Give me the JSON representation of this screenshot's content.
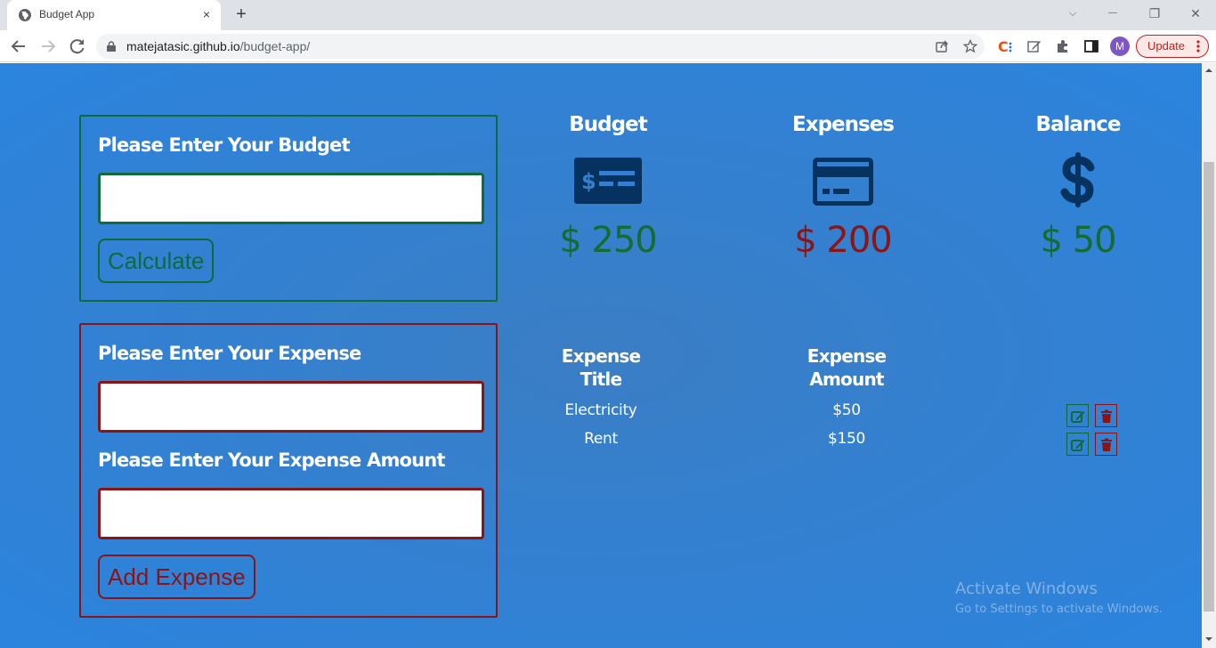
{
  "browser": {
    "tab": {
      "title": "Budget App",
      "close_label": "×",
      "favicon": "globe-icon"
    },
    "new_tab_label": "+",
    "window_controls": {
      "tab_search": "⌵",
      "minimize": "—",
      "restore": "❐",
      "close": "✕"
    },
    "address": {
      "domain": "matejatasic.github.io",
      "path": "/budget-app/"
    },
    "profile_initial": "M",
    "update_label": "Update",
    "colors": {
      "update": "#c5221f",
      "avatar": "#7e57c2"
    }
  },
  "app": {
    "budget_form": {
      "label": "Please Enter Your Budget",
      "input_value": "",
      "button_label": "Calculate"
    },
    "expense_form": {
      "expense_label": "Please Enter Your Expense",
      "expense_value": "",
      "amount_label": "Please Enter Your Expense Amount",
      "amount_value": "",
      "button_label": "Add Expense"
    },
    "summary": [
      {
        "title": "Budget",
        "icon": "money-check-icon",
        "value": "$ 250"
      },
      {
        "title": "Expenses",
        "icon": "credit-card-icon",
        "value": "$ 200"
      },
      {
        "title": "Balance",
        "icon": "dollar-sign-icon",
        "value": "$ 50"
      }
    ],
    "expense_table": {
      "headers": [
        "Expense\nTitle",
        "Expense\nAmount"
      ],
      "header_lines": [
        [
          "Expense",
          "Title"
        ],
        [
          "Expense",
          "Amount"
        ]
      ],
      "rows": [
        {
          "title": "Electricity",
          "amount": "$50"
        },
        {
          "title": "Rent",
          "amount": "$150"
        }
      ]
    },
    "colors": {
      "positive": "#146c34",
      "negative": "#8b1414",
      "icon": "#06325f",
      "background": "#3480d0"
    }
  },
  "watermark": {
    "title": "Activate Windows",
    "subtitle": "Go to Settings to activate Windows."
  }
}
